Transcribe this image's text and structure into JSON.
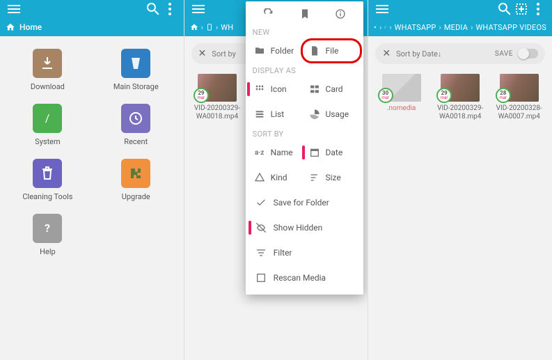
{
  "screen1": {
    "home_label": "Home",
    "items": [
      {
        "label": "Download",
        "bg": "#a78463",
        "icon": "download"
      },
      {
        "label": "Main Storage",
        "bg": "#2f7fc5",
        "icon": "storage"
      },
      {
        "label": "System",
        "bg": "#4caf50",
        "icon": "slash"
      },
      {
        "label": "Recent",
        "bg": "#7b6fbf",
        "icon": "clock"
      },
      {
        "label": "Cleaning Tools",
        "bg": "#6b62c2",
        "icon": "trash"
      },
      {
        "label": "Upgrade",
        "bg": "#f2913d",
        "icon": "puzzle"
      },
      {
        "label": "Help",
        "bg": "#9e9e9e",
        "icon": "question"
      }
    ]
  },
  "screen2": {
    "breadcrumb": [
      "WhatsApp"
    ],
    "sortbar": {
      "label": "Sort by"
    },
    "files": [
      {
        "name": "VID-20200329-WA0018.mp4",
        "day": "29",
        "mon": "mar"
      }
    ],
    "menu": {
      "section_new": "NEW",
      "folder": "Folder",
      "file": "File",
      "section_display": "DISPLAY AS",
      "icon": "Icon",
      "card": "Card",
      "list": "List",
      "usage": "Usage",
      "section_sort": "SORT BY",
      "name": "Name",
      "date": "Date",
      "kind": "Kind",
      "size": "Size",
      "save_for_folder": "Save for Folder",
      "show_hidden": "Show Hidden",
      "filter": "Filter",
      "rescan": "Rescan Media"
    }
  },
  "screen3": {
    "breadcrumb": [
      "WhatsApp",
      "Media",
      "WhatsApp Videos"
    ],
    "sortbar": {
      "label": "Sort by Date↓",
      "save": "SAVE"
    },
    "files": [
      {
        "name": ".nomedia",
        "day": "30",
        "mon": "mar",
        "nomedia": true
      },
      {
        "name": "VID-20200329-WA0018.mp4",
        "day": "29",
        "mon": "mar"
      },
      {
        "name": "VID-20200328-WA0007.mp4",
        "day": "28",
        "mon": "mar"
      }
    ]
  }
}
